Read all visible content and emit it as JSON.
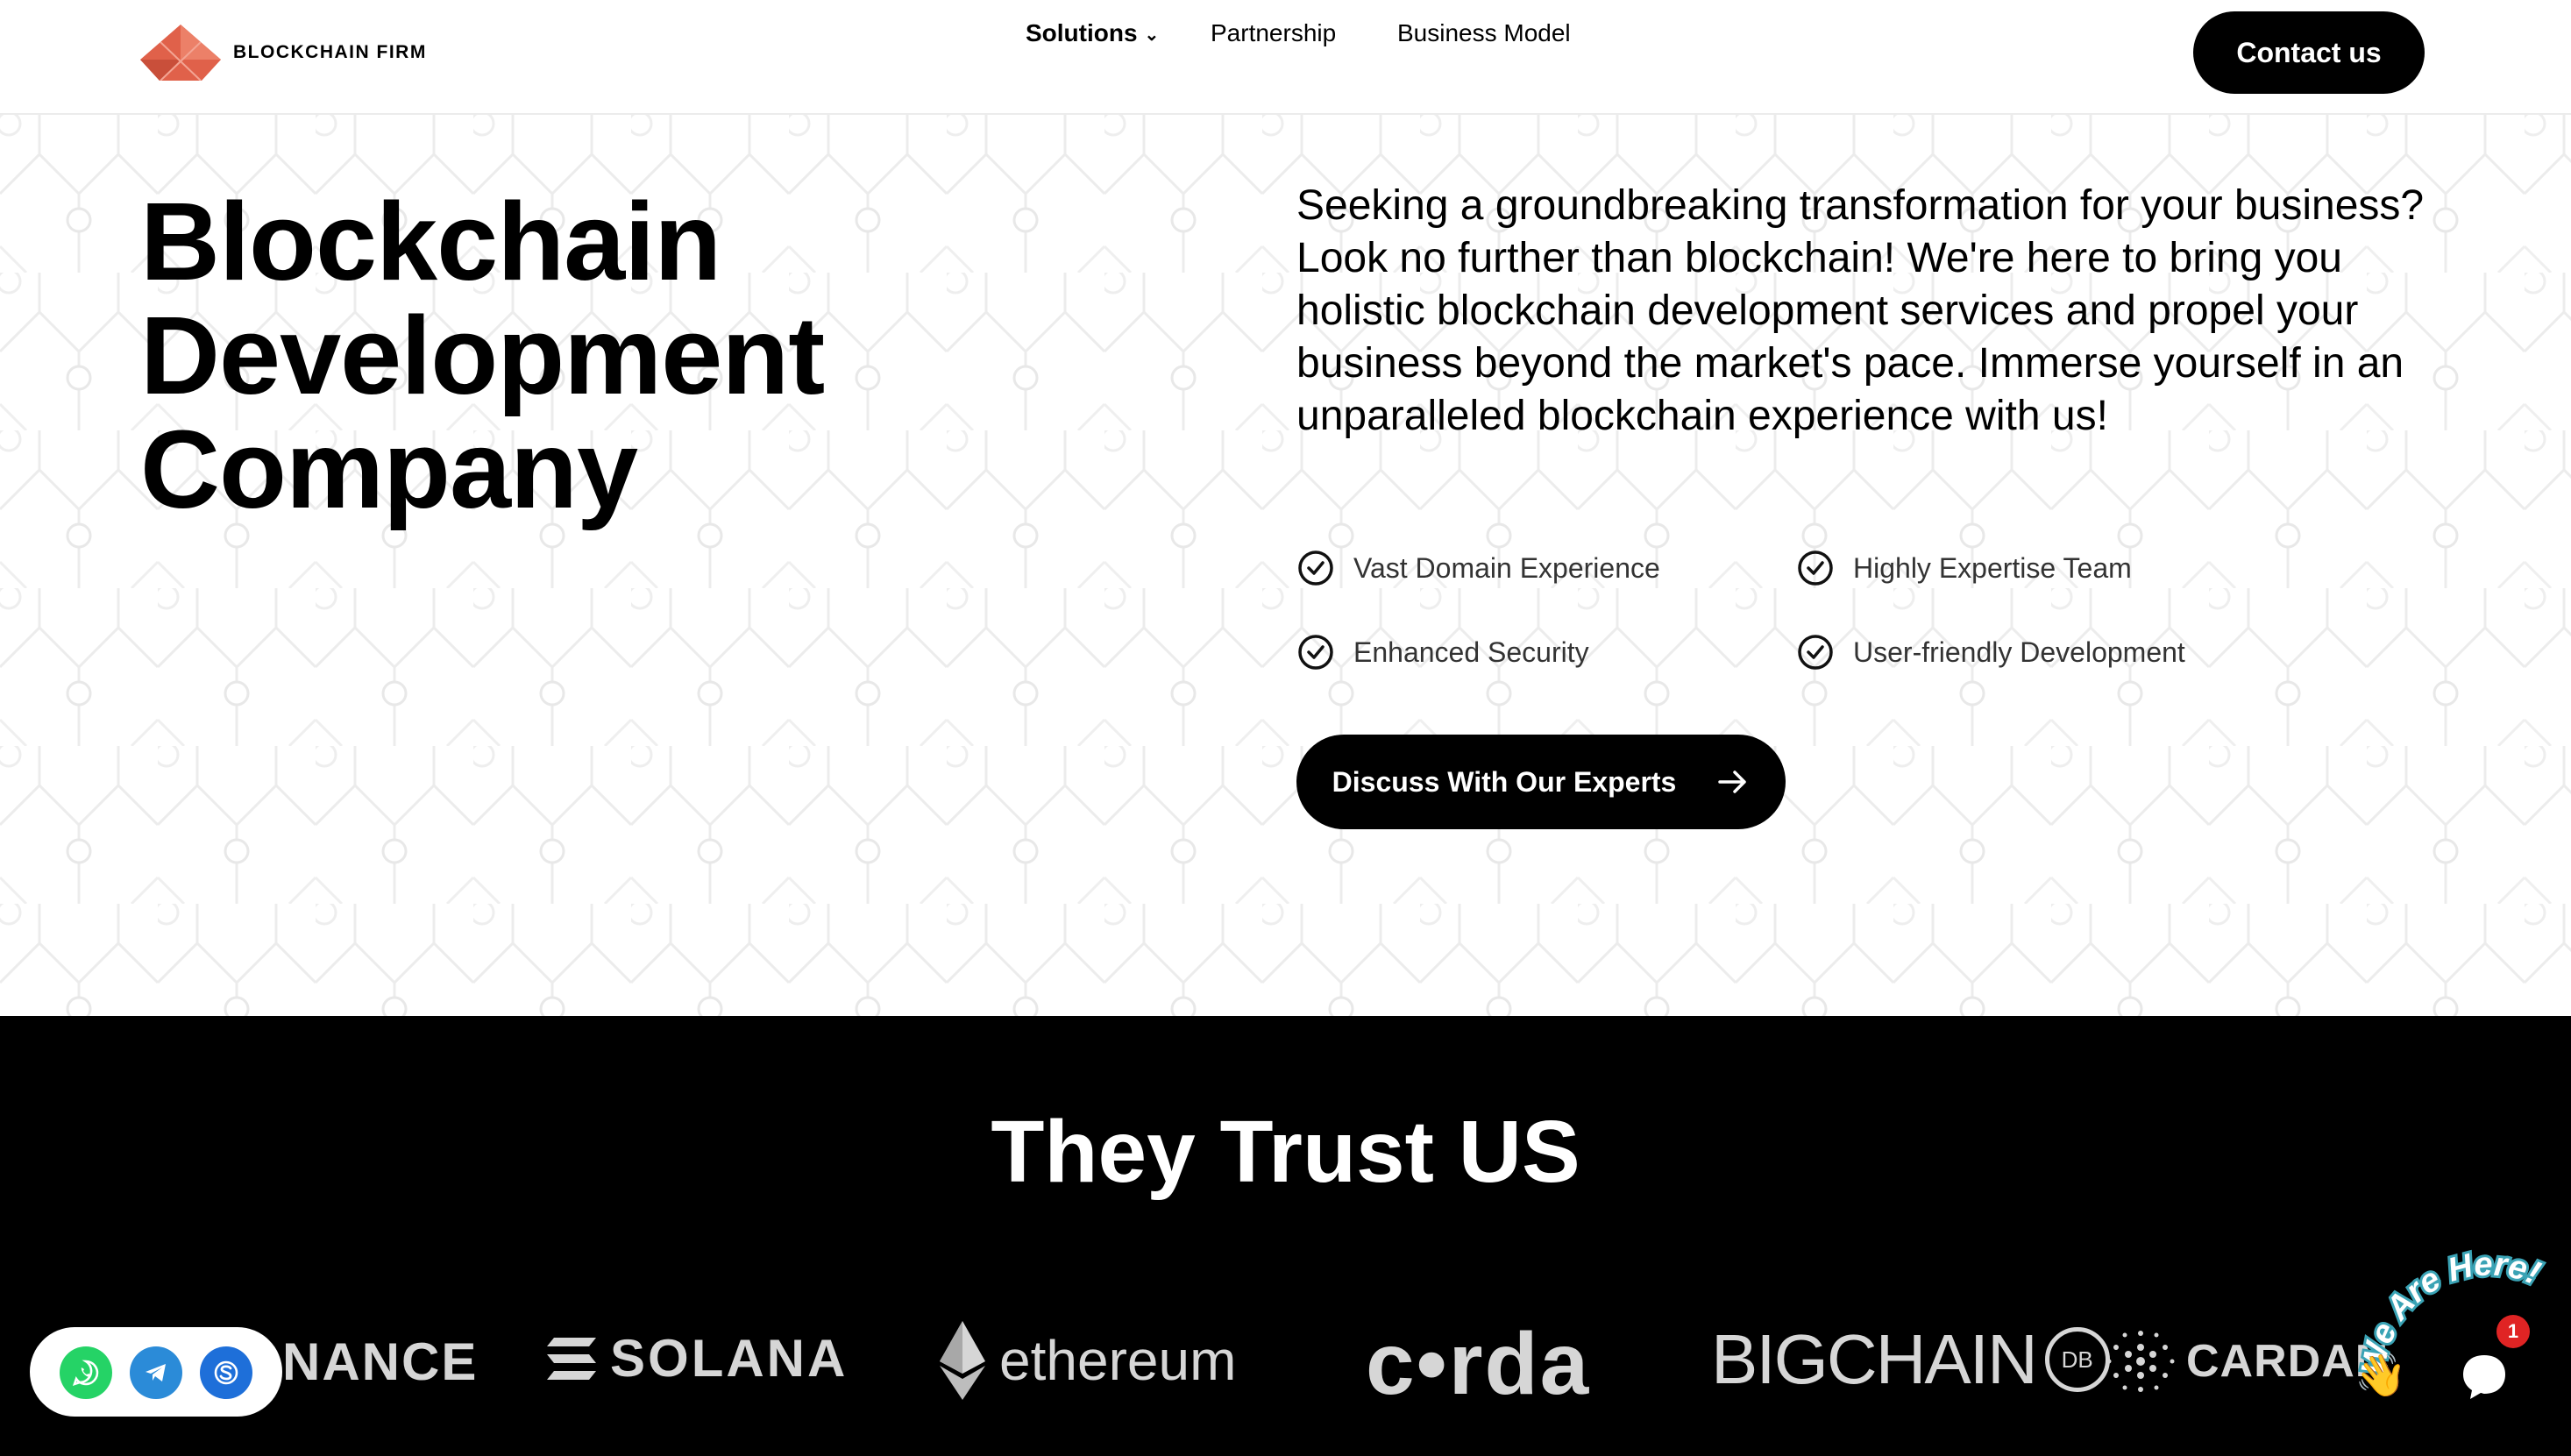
{
  "header": {
    "brand": "BLOCKCHAIN FIRM",
    "nav": {
      "solutions": "Solutions",
      "partnership": "Partnership",
      "business_model": "Business Model"
    },
    "contact_label": "Contact us"
  },
  "hero": {
    "title_lines": [
      "Blockchain",
      "Development",
      "Company"
    ],
    "description": "Seeking a groundbreaking transformation for your business? Look no further than blockchain! We're here to bring you holistic blockchain development services and propel your business beyond the market's pace. Immerse yourself in an unparalleled blockchain experience with us!",
    "features": [
      "Vast Domain Experience",
      "Highly Expertise Team",
      "Enhanced Security",
      "User-friendly Development"
    ],
    "cta_label": "Discuss With Our Experts"
  },
  "trust": {
    "title": "They Trust US",
    "logos": {
      "binance": "NANCE",
      "solana": "SOLANA",
      "ethereum": "ethereum",
      "corda": "c•rda",
      "bigchain": "BIGCHAIN",
      "bigchain_badge": "DB",
      "cardano": "CARDAN"
    }
  },
  "chat": {
    "badge_count": "1",
    "banner_text": "We Are Here!"
  },
  "colors": {
    "brand": "#e0614a",
    "dark": "#000000",
    "whatsapp": "#25d366",
    "telegram": "#2b8bd8",
    "skype": "#1e6fd9",
    "badge": "#e02424"
  }
}
